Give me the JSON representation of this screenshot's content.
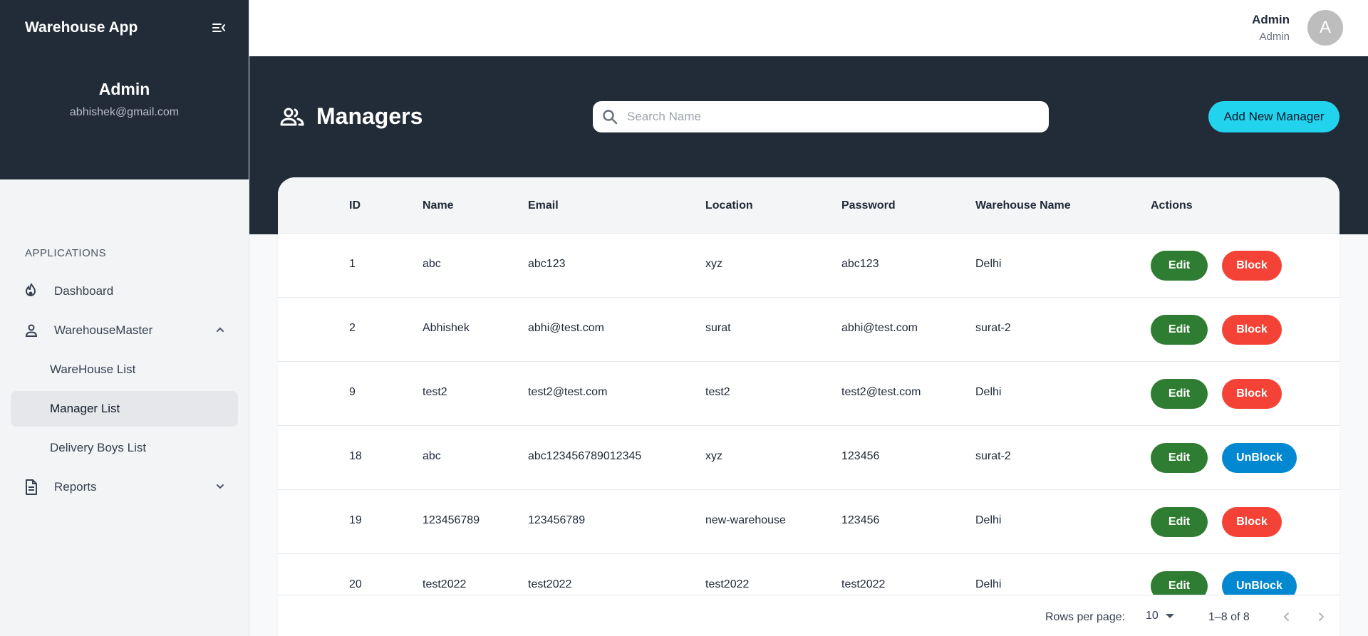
{
  "sidebar": {
    "app_title": "Warehouse App",
    "profile": {
      "name": "Admin",
      "email": "abhishek@gmail.com"
    },
    "section_label": "APPLICATIONS",
    "items": [
      {
        "label": "Dashboard",
        "icon": "fire-icon"
      },
      {
        "label": "WarehouseMaster",
        "icon": "person-icon",
        "expanded": true
      },
      {
        "label": "Reports",
        "icon": "document-icon",
        "expanded": false
      }
    ],
    "sub_items": [
      {
        "label": "WareHouse List",
        "active": false
      },
      {
        "label": "Manager List",
        "active": true
      },
      {
        "label": "Delivery Boys List",
        "active": false
      }
    ]
  },
  "topbar": {
    "user_name": "Admin",
    "user_role": "Admin",
    "avatar_initial": "A"
  },
  "header": {
    "title": "Managers",
    "search_placeholder": "Search Name",
    "add_button": "Add New Manager"
  },
  "table": {
    "columns": [
      "ID",
      "Name",
      "Email",
      "Location",
      "Password",
      "Warehouse Name",
      "Actions"
    ],
    "rows": [
      {
        "id": "1",
        "name": "abc",
        "email": "abc123",
        "location": "xyz",
        "password": "abc123",
        "warehouse": "Delhi",
        "edit": "Edit",
        "toggle": "Block"
      },
      {
        "id": "2",
        "name": "Abhishek",
        "email": "abhi@test.com",
        "location": "surat",
        "password": "abhi@test.com",
        "warehouse": "surat-2",
        "edit": "Edit",
        "toggle": "Block"
      },
      {
        "id": "9",
        "name": "test2",
        "email": "test2@test.com",
        "location": "test2",
        "password": "test2@test.com",
        "warehouse": "Delhi",
        "edit": "Edit",
        "toggle": "Block"
      },
      {
        "id": "18",
        "name": "abc",
        "email": "abc123456789012345",
        "location": "xyz",
        "password": "123456",
        "warehouse": "surat-2",
        "edit": "Edit",
        "toggle": "UnBlock"
      },
      {
        "id": "19",
        "name": "123456789",
        "email": "123456789",
        "location": "new-warehouse",
        "password": "123456",
        "warehouse": "Delhi",
        "edit": "Edit",
        "toggle": "Block"
      },
      {
        "id": "20",
        "name": "test2022",
        "email": "test2022",
        "location": "test2022",
        "password": "test2022",
        "warehouse": "Delhi",
        "edit": "Edit",
        "toggle": "UnBlock"
      }
    ]
  },
  "pagination": {
    "rows_per_page_label": "Rows per page:",
    "rows_per_page": "10",
    "range": "1–8 of 8"
  },
  "colors": {
    "sidebar_dark": "#222b38",
    "accent_cyan": "#22d3ee",
    "edit_green": "#2e7d32",
    "block_red": "#f44336",
    "unblock_blue": "#0288d1"
  }
}
